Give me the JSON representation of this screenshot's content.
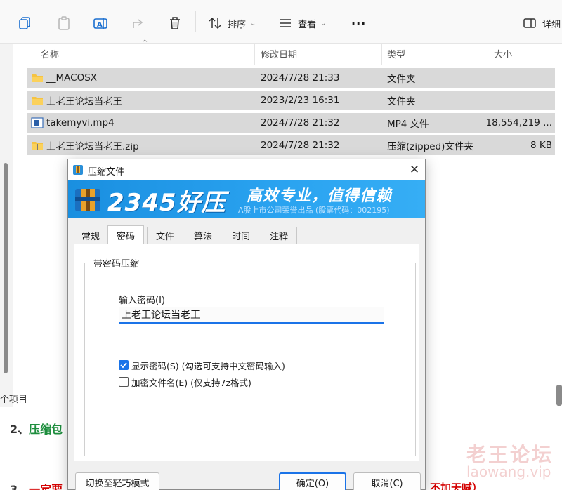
{
  "explorer": {
    "toolbar": {
      "sort_label": "排序",
      "view_label": "查看",
      "more_label": "···",
      "details_label": "详细"
    },
    "columns": {
      "name": "名称",
      "date": "修改日期",
      "type": "类型",
      "size": "大小"
    },
    "files": [
      {
        "name": "__MACOSX",
        "date": "2024/7/28 21:33",
        "type": "文件夹",
        "size": "",
        "icon": "folder-icon"
      },
      {
        "name": "上老王论坛当老王",
        "date": "2023/2/23 16:31",
        "type": "文件夹",
        "size": "",
        "icon": "folder-icon"
      },
      {
        "name": "takemyvi.mp4",
        "date": "2024/7/28 21:32",
        "type": "MP4 文件",
        "size": "18,554,219 ...",
        "icon": "video-file-icon"
      },
      {
        "name": "上老王论坛当老王.zip",
        "date": "2024/7/28 21:32",
        "type": "压缩(zipped)文件夹",
        "size": "8 KB",
        "icon": "zip-folder-icon"
      }
    ],
    "status_text": "个项目"
  },
  "article": {
    "heading_prefix": "2、",
    "heading_green": "压缩包",
    "heading3_prefix": "3、",
    "heading3_red": "一定要",
    "heading3_tail": "不加天喊）",
    "watermark_line1": "老王论坛",
    "watermark_line2": "laowang.vip"
  },
  "dialog": {
    "title": "压缩文件",
    "banner_brand": "2345好压",
    "banner_slogan": "高效专业，值得信赖",
    "banner_sub": "A股上市公司荣誉出品 (股票代码：002195)",
    "tabs": [
      "常规",
      "密码",
      "文件",
      "算法",
      "时间",
      "注释"
    ],
    "active_tab": "密码",
    "group_title": "带密码压缩",
    "password_label": "输入密码(I)",
    "password_value": "上老王论坛当老王",
    "show_password_label": "显示密码(S) (勾选可支持中文密码输入)",
    "show_password_checked": true,
    "encrypt_names_label": "加密文件名(E) (仅支持7z格式)",
    "encrypt_names_checked": false,
    "switch_mode_label": "切换至轻巧模式",
    "ok_label": "确定(O)",
    "cancel_label": "取消(C)"
  },
  "colors": {
    "accent": "#1a73e8",
    "banner_blue": "#2aa3f0",
    "folder_yellow": "#f5c342",
    "selection_gray": "#d9d9d9"
  }
}
